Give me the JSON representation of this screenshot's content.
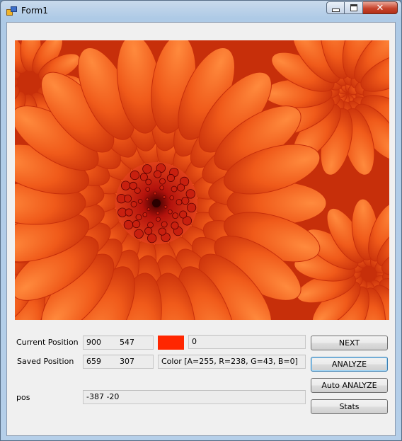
{
  "window": {
    "title": "Form1",
    "minimize_icon": "minimize-icon",
    "maximize_icon": "maximize-icon",
    "close_icon": "close-icon",
    "close_glyph": "✕"
  },
  "image": {
    "icon": "flower-image",
    "colors": {
      "petal": "#f05a1a",
      "petal_light": "#ff8a3d",
      "petal_dark": "#c72f0a",
      "center": "#b3120c"
    }
  },
  "current_position": {
    "label": "Current Position",
    "x": "900",
    "y": "547"
  },
  "saved_position": {
    "label": "Saved Position",
    "x": "659",
    "y": "307"
  },
  "color_swatch": {
    "color": "#ff2600"
  },
  "count_field": {
    "value": "0"
  },
  "color_field": {
    "value": "Color [A=255, R=238, G=43, B=0]"
  },
  "pos": {
    "label": "pos",
    "value": "-387 -20"
  },
  "buttons": {
    "next": "NEXT",
    "analyze": "ANALYZE",
    "auto_analyze": "Auto ANALYZE",
    "stats": "Stats"
  }
}
